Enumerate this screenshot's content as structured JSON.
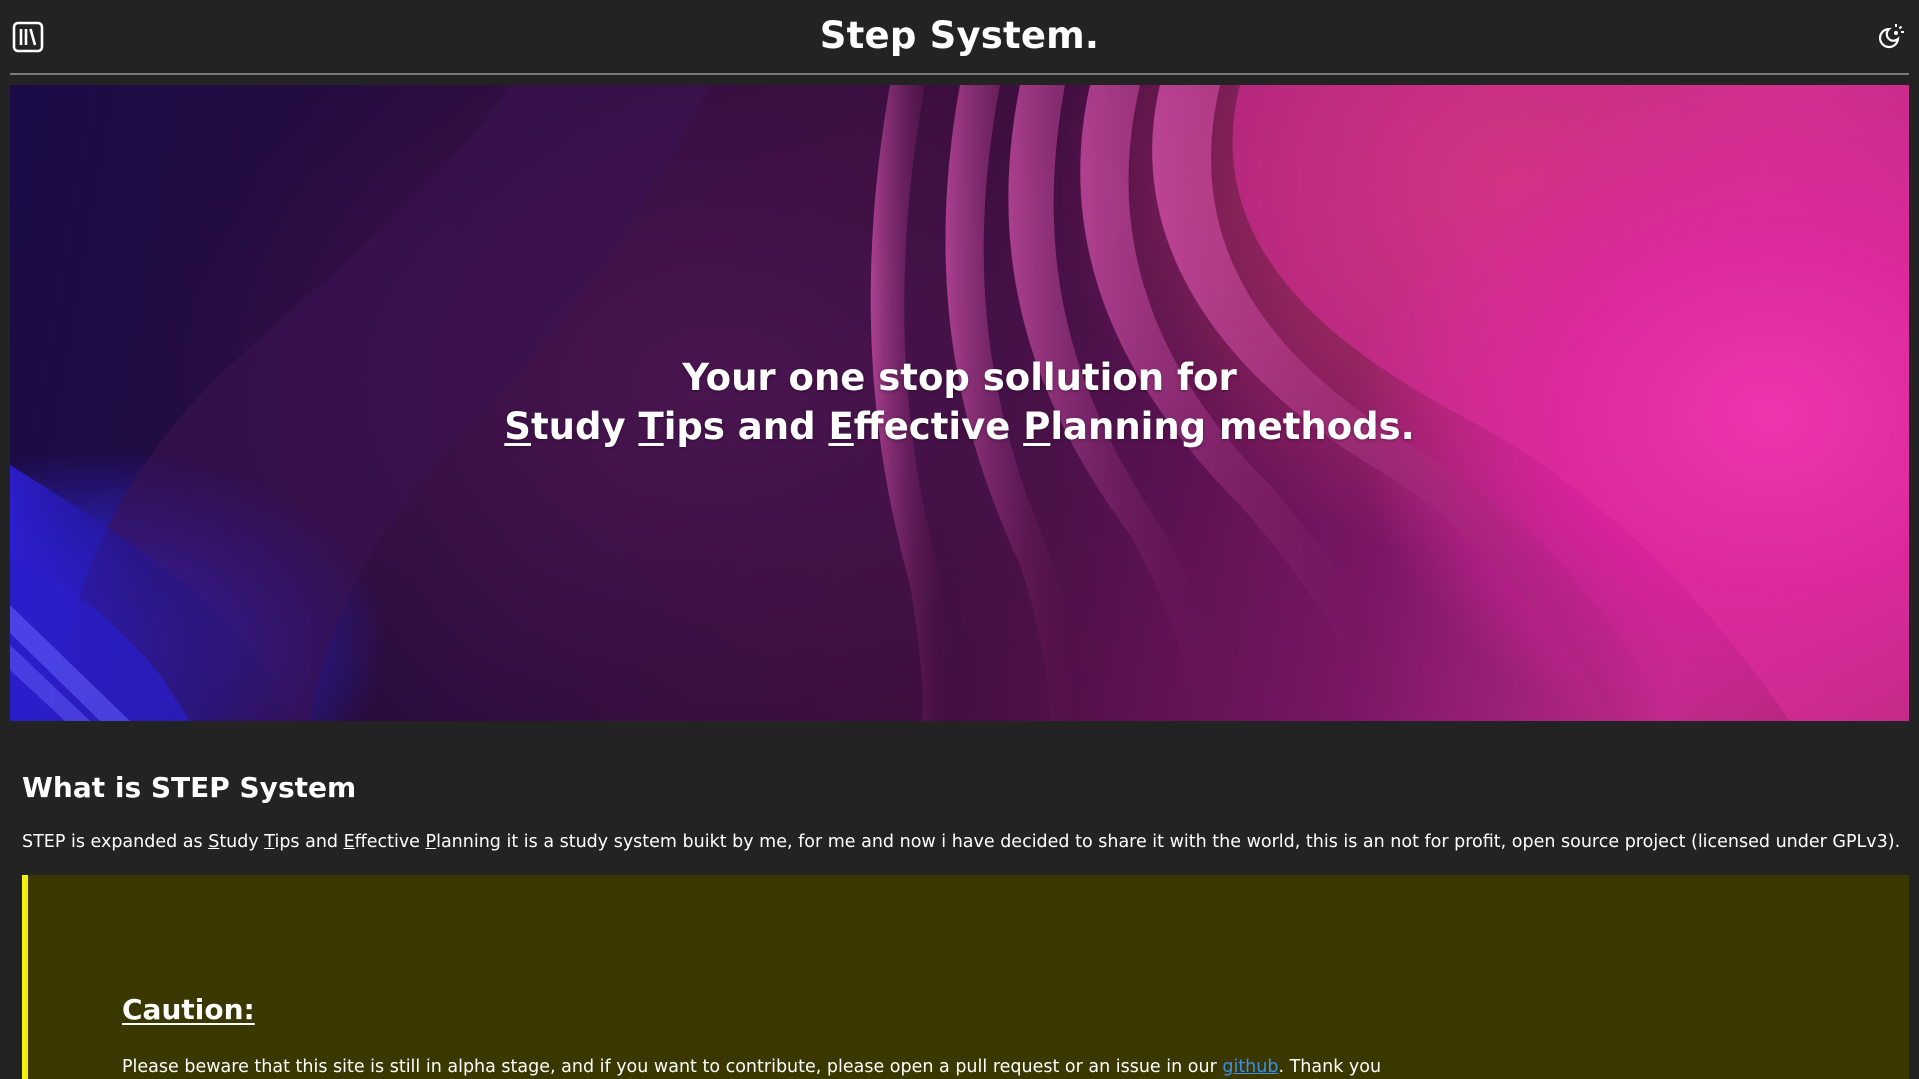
{
  "header": {
    "title": "Step System.",
    "menu_icon": "library-icon",
    "theme_icon": "theme-toggle-icon"
  },
  "hero": {
    "line1": "Your one stop sollution for",
    "line2": {
      "s_initial": "S",
      "s_rest": "tudy ",
      "t_initial": "T",
      "t_rest": "ips and ",
      "e_initial": "E",
      "e_rest": "ffective ",
      "p_initial": "P",
      "p_rest": "lanning methods."
    }
  },
  "about": {
    "title": "What is STEP System",
    "text_prefix": "STEP is expanded as ",
    "s_initial": "S",
    "s_rest": "tudy ",
    "t_initial": "T",
    "t_rest": "ips and ",
    "e_initial": "E",
    "e_rest": "ffective ",
    "p_initial": "P",
    "p_rest": "lanning",
    "text_suffix": " it is a study system buikt by me, for me and now i have decided to share it with the world, this is an not for profit, open source project (licensed under GPLv3)."
  },
  "caution": {
    "title": "Caution:",
    "text_before": "Please beware that this site is still in alpha stage, and if you want to contribute, please open a pull request or an issue in our ",
    "link_text": "github",
    "text_after": ". Thank you",
    "accent_color": "#f2f20a",
    "background_color": "#3a3800"
  },
  "colors": {
    "page_background": "#232323",
    "link": "#3b8fe8"
  }
}
